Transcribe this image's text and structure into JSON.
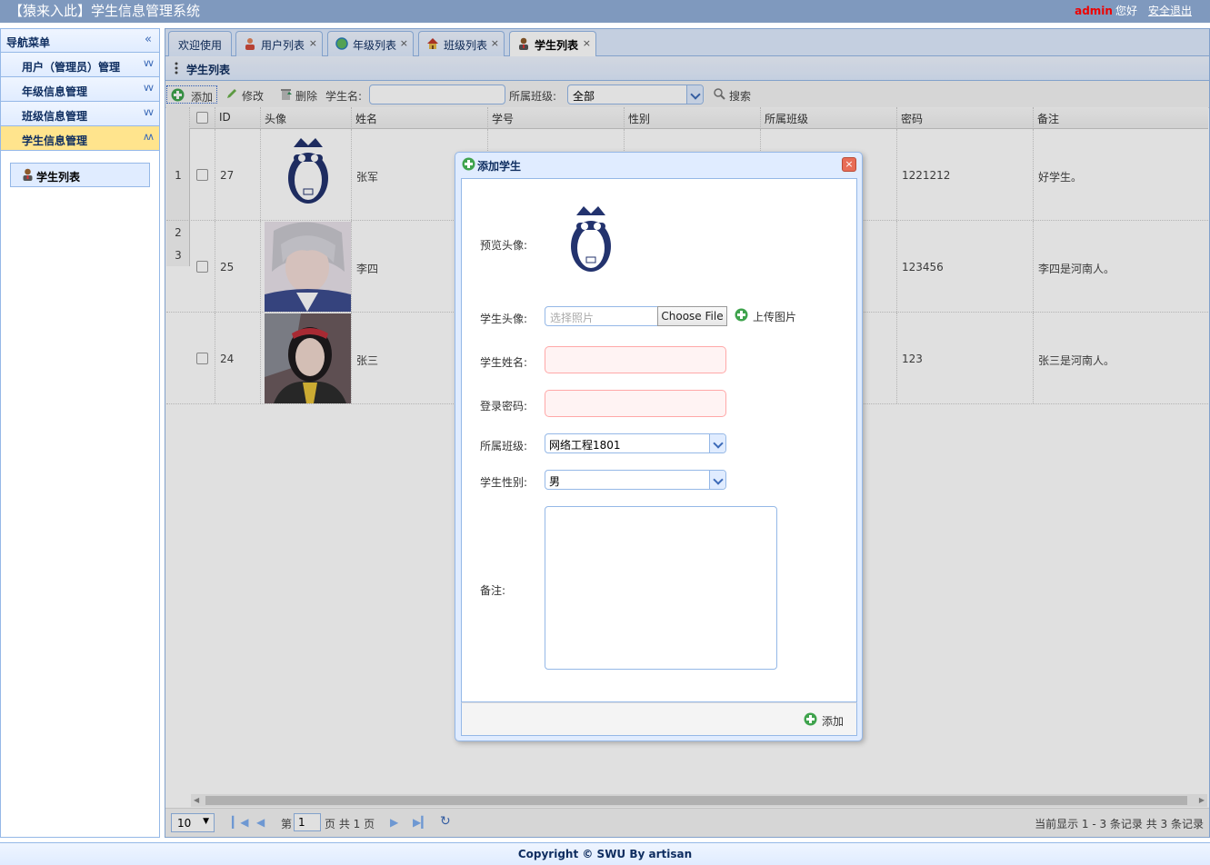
{
  "header": {
    "title": "【猿来入此】学生信息管理系统",
    "admin": "admin",
    "greeting": "您好",
    "logout": "安全退出"
  },
  "sidebar": {
    "title": "导航菜单",
    "items": [
      {
        "label": "用户（管理员）管理"
      },
      {
        "label": "年级信息管理"
      },
      {
        "label": "班级信息管理"
      },
      {
        "label": "学生信息管理"
      }
    ],
    "sub_items": [
      {
        "label": "学生列表"
      }
    ]
  },
  "tabs": [
    {
      "label": "欢迎使用"
    },
    {
      "label": "用户列表"
    },
    {
      "label": "年级列表"
    },
    {
      "label": "班级列表"
    },
    {
      "label": "学生列表"
    }
  ],
  "panel": {
    "title": "学生列表"
  },
  "toolbar": {
    "add": "添加",
    "edit": "修改",
    "delete": "删除",
    "name_label": "学生名:",
    "class_label": "所属班级:",
    "class_value": "全部",
    "search": "搜索"
  },
  "grid": {
    "columns": [
      "ID",
      "头像",
      "姓名",
      "学号",
      "性别",
      "所属班级",
      "密码",
      "备注"
    ],
    "row_numbers": [
      "1",
      "2",
      "3"
    ],
    "rows": [
      {
        "id": "27",
        "name": "张军",
        "password": "1221212",
        "remark": "好学生。"
      },
      {
        "id": "25",
        "name": "李四",
        "password": "123456",
        "remark": "李四是河南人。"
      },
      {
        "id": "24",
        "name": "张三",
        "password": "123",
        "remark": "张三是河南人。"
      }
    ]
  },
  "pager": {
    "page_size": "10",
    "page_prefix": "第",
    "page_value": "1",
    "page_suffix": "页 共 1 页",
    "info": "当前显示 1 - 3 条记录 共 3 条记录"
  },
  "footer": {
    "text": "Copyright © SWU By artisan"
  },
  "dialog": {
    "title": "添加学生",
    "preview_label": "预览头像:",
    "photo_label": "学生头像:",
    "photo_placeholder": "选择照片",
    "choose_file": "Choose File",
    "upload": "上传图片",
    "name_label": "学生姓名:",
    "password_label": "登录密码:",
    "class_label": "所属班级:",
    "class_value": "网络工程1801",
    "gender_label": "学生性别:",
    "gender_value": "男",
    "remark_label": "备注:",
    "submit": "添加"
  },
  "colors": {
    "accent": "#95b8e7",
    "header": "#7f99be",
    "active_menu": "#ffe48d",
    "admin": "#ee0000"
  }
}
